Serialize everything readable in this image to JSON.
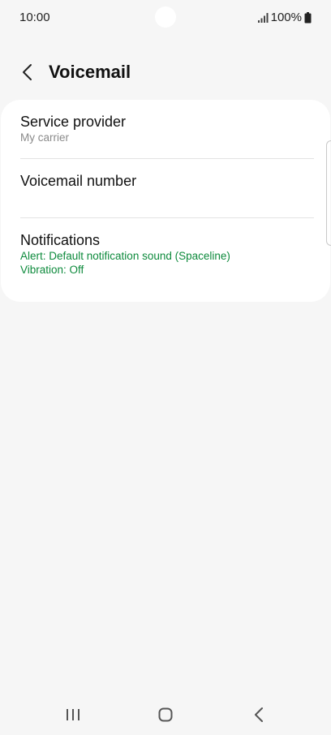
{
  "status_bar": {
    "time": "10:00",
    "battery": "100%"
  },
  "header": {
    "title": "Voicemail",
    "back_icon": "chevron-left-icon"
  },
  "settings": {
    "items": [
      {
        "title": "Service provider",
        "subtitle": "My carrier"
      },
      {
        "title": "Voicemail number",
        "subtitle": ""
      },
      {
        "title": "Notifications",
        "subtitle_lines": [
          "Alert: Default notification sound (Spaceline)",
          "Vibration: Off"
        ]
      }
    ]
  },
  "colors": {
    "background": "#f6f6f6",
    "card": "#ffffff",
    "accent_green": "#0d8a3c",
    "secondary_text": "#8a8a8a"
  },
  "nav_bar": {
    "recents_icon": "recents-icon",
    "home_icon": "home-icon",
    "back_icon": "back-icon"
  }
}
